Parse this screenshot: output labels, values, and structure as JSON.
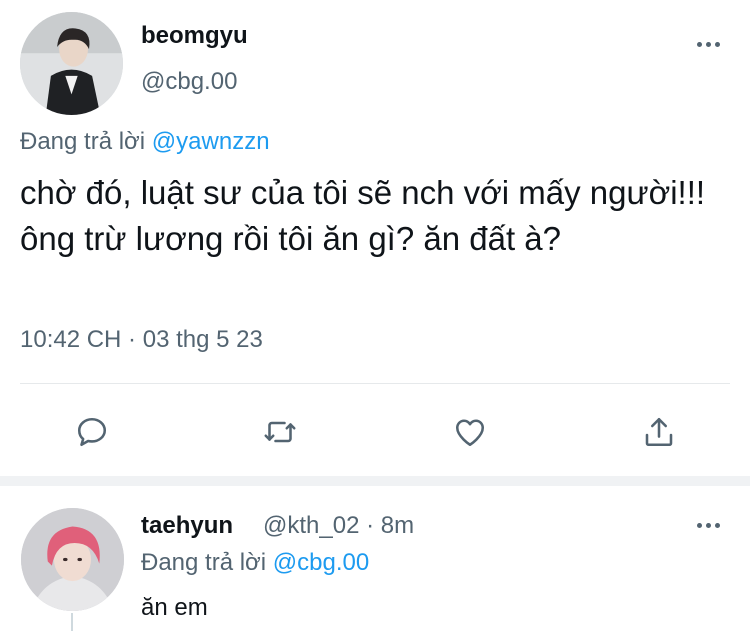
{
  "tweet": {
    "author_name": "beomgyu",
    "author_handle": "@cbg.00",
    "replying_prefix": "Đang trả lời",
    "replying_to": "@yawnzzn",
    "text": "chờ đó, luật sư của tôi sẽ nch với mấy người!!! ông trừ lương rồi tôi ăn gì? ăn đất à?",
    "timestamp": "10:42 CH · 03 thg 5 23",
    "actions": [
      "reply-icon",
      "retweet-icon",
      "like-icon",
      "share-icon"
    ]
  },
  "reply": {
    "author_name": "taehyun",
    "author_handle": "@kth_02",
    "time_separator": "·",
    "time": "8m",
    "replying_prefix": "Đang trả lời",
    "replying_to": "@cbg.00",
    "text": "ăn em"
  },
  "colors": {
    "text_primary": "#0f1419",
    "text_secondary": "#536471",
    "link": "#1d9bf0",
    "divider": "#e6e9eb",
    "reply_avatar_hair": "#e0607a"
  }
}
